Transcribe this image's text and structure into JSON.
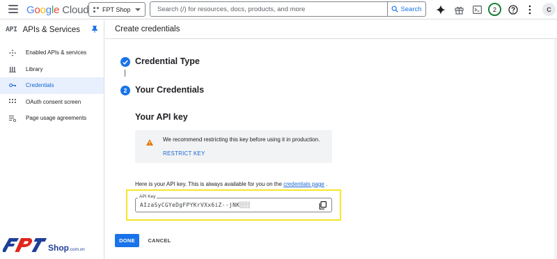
{
  "header": {
    "logo_google": "Google",
    "logo_cloud": "Cloud",
    "project": "FPT Shop",
    "search_placeholder": "Search (/) for resources, docs, products, and more",
    "search_button": "Search",
    "notifications_count": "2",
    "avatar_initial": "C"
  },
  "sidebar": {
    "api_badge": "API",
    "title": "APIs & Services",
    "items": [
      {
        "label": "Enabled APIs & services",
        "icon": "diamond-icon"
      },
      {
        "label": "Library",
        "icon": "library-icon"
      },
      {
        "label": "Credentials",
        "icon": "key-icon",
        "active": true
      },
      {
        "label": "OAuth consent screen",
        "icon": "oauth-icon"
      },
      {
        "label": "Page usage agreements",
        "icon": "settings-list-icon"
      }
    ]
  },
  "main": {
    "page_title": "Create credentials",
    "step1_title": "Credential Type",
    "step2_number": "2",
    "step2_title": "Your Credentials",
    "key_heading": "Your API key",
    "warning_text": "We recommend restricting this key before using it in production.",
    "restrict_link": "RESTRICT KEY",
    "here_text_prefix": "Here is your API key. This is always available for you on the ",
    "here_text_link": "credentials page",
    "here_text_suffix": " .",
    "key_label": "API Key",
    "key_value": "AIzaSyCGYeDgFPYKrVXx6iZ--jNK░░░",
    "done_button": "DONE",
    "cancel_button": "CANCEL"
  },
  "colors": {
    "accent": "#1a73e8",
    "highlight": "#f7e626",
    "warning": "#e37400"
  },
  "watermark": {
    "brand": "FPT",
    "suffix": "Shop",
    "domain": ".com.vn"
  }
}
